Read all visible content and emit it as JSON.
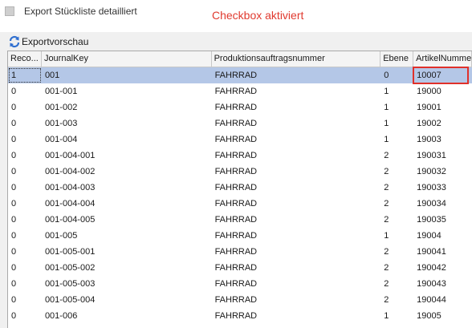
{
  "window": {
    "title": "Export Stückliste detailliert"
  },
  "annotation": {
    "text": "Checkbox aktiviert",
    "color": "#e03a2f"
  },
  "toolbar": {
    "export_preview_label": "Exportvorschau",
    "export_preview_icon": "refresh-arrows-icon"
  },
  "grid": {
    "columns": [
      "Reco...",
      "JournalKey",
      "Produktionsauftragsnummer",
      "Ebene",
      "ArtikelNummer"
    ],
    "selected_row": 0,
    "highlighted_cell": "10007",
    "rows": [
      [
        "1",
        "001",
        "FAHRRAD",
        "0",
        "10007"
      ],
      [
        "0",
        "001-001",
        "FAHRRAD",
        "1",
        "19000"
      ],
      [
        "0",
        "001-002",
        "FAHRRAD",
        "1",
        "19001"
      ],
      [
        "0",
        "001-003",
        "FAHRRAD",
        "1",
        "19002"
      ],
      [
        "0",
        "001-004",
        "FAHRRAD",
        "1",
        "19003"
      ],
      [
        "0",
        "001-004-001",
        "FAHRRAD",
        "2",
        "190031"
      ],
      [
        "0",
        "001-004-002",
        "FAHRRAD",
        "2",
        "190032"
      ],
      [
        "0",
        "001-004-003",
        "FAHRRAD",
        "2",
        "190033"
      ],
      [
        "0",
        "001-004-004",
        "FAHRRAD",
        "2",
        "190034"
      ],
      [
        "0",
        "001-004-005",
        "FAHRRAD",
        "2",
        "190035"
      ],
      [
        "0",
        "001-005",
        "FAHRRAD",
        "1",
        "19004"
      ],
      [
        "0",
        "001-005-001",
        "FAHRRAD",
        "2",
        "190041"
      ],
      [
        "0",
        "001-005-002",
        "FAHRRAD",
        "2",
        "190042"
      ],
      [
        "0",
        "001-005-003",
        "FAHRRAD",
        "2",
        "190043"
      ],
      [
        "0",
        "001-005-004",
        "FAHRRAD",
        "2",
        "190044"
      ],
      [
        "0",
        "001-006",
        "FAHRRAD",
        "1",
        "19005"
      ]
    ]
  }
}
